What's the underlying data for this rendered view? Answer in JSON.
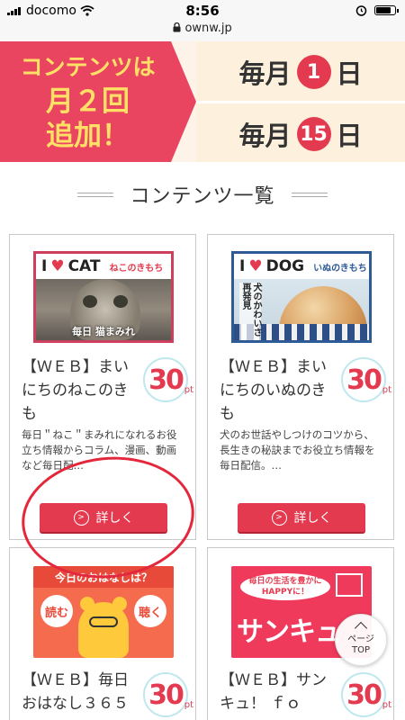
{
  "status_bar": {
    "carrier": "docomo",
    "time": "8:56",
    "url": "ownw.jp",
    "lock_icon": "lock-icon",
    "wifi_icon": "wifi-icon"
  },
  "banner": {
    "left_lines": [
      "コンテンツは",
      "月２回",
      "追加！"
    ],
    "line1_prefix": "毎月",
    "line1_day": "1",
    "line1_suffix": "日",
    "line2_prefix": "毎月",
    "line2_day": "15",
    "line2_suffix": "日",
    "accent": "#e94560",
    "text_accent": "#ffe066"
  },
  "section": {
    "title": "コンテンツ一覧"
  },
  "cards": [
    {
      "thumb_head_word": "CAT",
      "thumb_head_small": "ねこのきもち",
      "thumb_tag": "毎日 猫まみれ",
      "title": "【ＷＥＢ】まいにちのねこのきも",
      "points": "30",
      "points_unit": "pt",
      "desc": "毎日＂ねこ＂まみれになれるお役立ち情報からコラム、漫画、動画など毎日配…",
      "button": "詳しく"
    },
    {
      "thumb_head_word": "DOG",
      "thumb_head_small": "いぬのきもち",
      "thumb_vtext": "犬のかわいさ再発見",
      "title": "【ＷＥＢ】まいにちのいぬのきも",
      "points": "30",
      "points_unit": "pt",
      "desc": "犬のお世話やしつけのコツから、長生きの秘訣までお役立ち情報を毎日配信。…",
      "button": "詳しく"
    },
    {
      "thumb_band": "今日のおはなしは？",
      "bubble_left": "読む",
      "bubble_right": "聴く",
      "title": "【ＷＥＢ】毎日おはなし３６５",
      "points": "30",
      "points_unit": "pt"
    },
    {
      "thumb_bubble": "毎日の生活を豊かにHAPPYに！",
      "thumb_big": "サンキュ",
      "title": "【ＷＥＢ】サンキュ！ ｆｏ",
      "points": "30",
      "points_unit": "pt"
    }
  ],
  "page_top": {
    "line1": "ページ",
    "line2": "TOP"
  }
}
